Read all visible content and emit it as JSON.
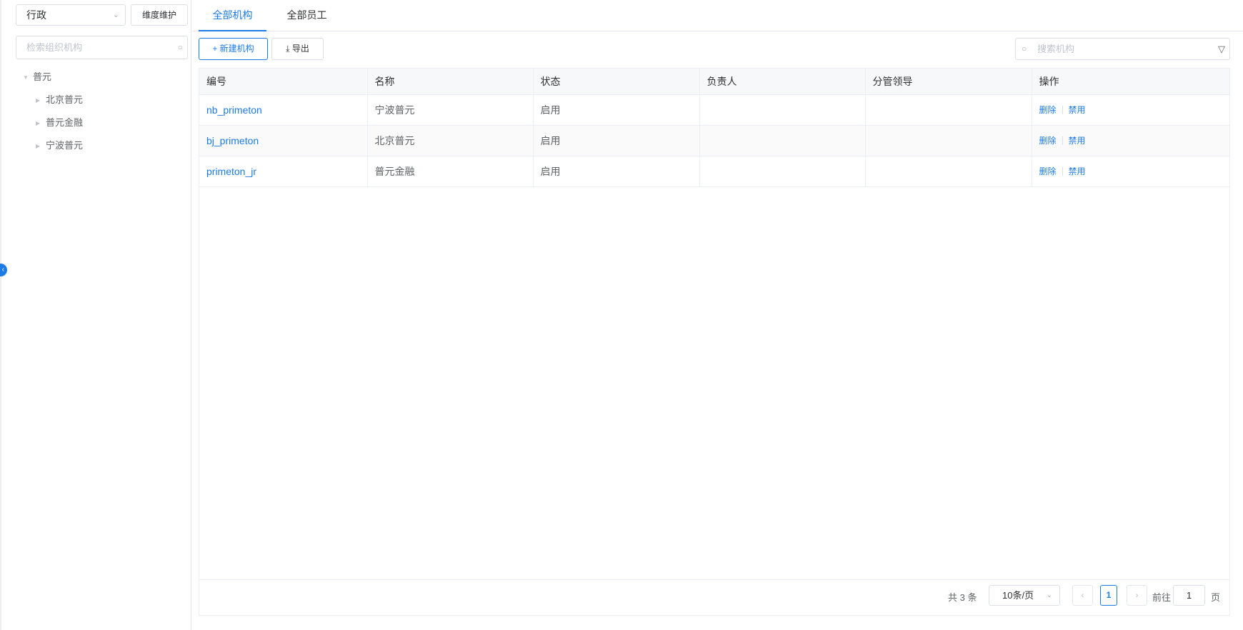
{
  "sidebar": {
    "dimension_select": "行政",
    "dimension_button": "维度维护",
    "search_placeholder": "检索组织机构",
    "tree": {
      "root": "普元",
      "children": [
        "北京普元",
        "普元金融",
        "宁波普元"
      ]
    }
  },
  "tabs": [
    {
      "label": "全部机构",
      "active": true
    },
    {
      "label": "全部员工",
      "active": false
    }
  ],
  "toolbar": {
    "new_label": "新建机构",
    "export_label": "导出",
    "search_placeholder": "搜索机构"
  },
  "table": {
    "columns": [
      "编号",
      "名称",
      "状态",
      "负责人",
      "分管领导",
      "操作"
    ],
    "rows": [
      {
        "code": "nb_primeton",
        "name": "宁波普元",
        "status": "启用",
        "owner": "",
        "leader": "",
        "op_delete": "删除",
        "op_disable": "禁用"
      },
      {
        "code": "bj_primeton",
        "name": "北京普元",
        "status": "启用",
        "owner": "",
        "leader": "",
        "op_delete": "删除",
        "op_disable": "禁用"
      },
      {
        "code": "primeton_jr",
        "name": "普元金融",
        "status": "启用",
        "owner": "",
        "leader": "",
        "op_delete": "删除",
        "op_disable": "禁用"
      }
    ]
  },
  "pagination": {
    "total_text": "共 3 条",
    "page_size": "10条/页",
    "current_page": "1",
    "goto_prefix": "前往",
    "goto_value": "1",
    "goto_suffix": "页"
  },
  "colors": {
    "accent": "#1e7be6"
  }
}
